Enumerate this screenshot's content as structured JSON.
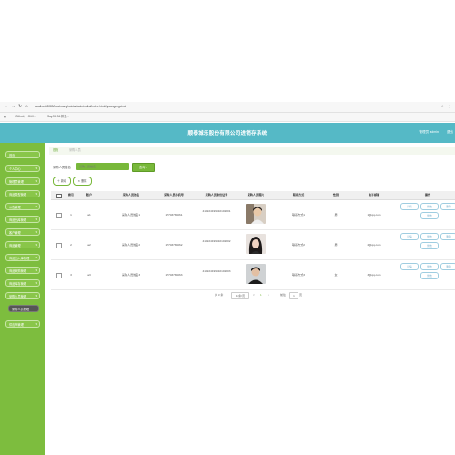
{
  "browser": {
    "url": "localhost:8080/louchuanghuixiao/admin/dist/index.html#/yuangongxinxi",
    "bookmarks": [
      "【Github】 GitH...",
      "SayCA 06.排之..."
    ]
  },
  "header": {
    "title": "顺泰城乐股份有限公司进销存系统",
    "user": "管理员 admin",
    "exit": "退出"
  },
  "sidebar": {
    "items": [
      {
        "label": "首页",
        "arrow": ""
      },
      {
        "label": "个人中心",
        "arrow": "▾"
      },
      {
        "label": "管理员管理",
        "arrow": "▾"
      },
      {
        "label": "商品类型管理",
        "arrow": "▾"
      },
      {
        "label": "公告管理",
        "arrow": "▾"
      },
      {
        "label": "商品出库管理",
        "arrow": "▾"
      },
      {
        "label": "客户管理",
        "arrow": "▾"
      },
      {
        "label": "商品管理",
        "arrow": "▾"
      },
      {
        "label": "商品出入库管理",
        "arrow": "▾"
      },
      {
        "label": "商品采购管理",
        "arrow": "▾"
      },
      {
        "label": "商品库存管理",
        "arrow": "▾"
      },
      {
        "label": "采购人员管理",
        "arrow": "▾"
      },
      {
        "label": "采购人员管理",
        "arrow": ""
      },
      {
        "label": "供应商管理",
        "arrow": "▾"
      }
    ]
  },
  "breadcrumb": {
    "home": "首页",
    "current": "采购人员"
  },
  "search": {
    "label": "采购人员姓名",
    "placeholder": "采购人员姓名",
    "button": "查询"
  },
  "actions": {
    "add": "新增",
    "delete": "删除"
  },
  "table": {
    "columns": [
      "索引",
      "账户",
      "采购人员姓名",
      "采购人员手机号",
      "采购人员身份证号",
      "采购人员照片",
      "联系方式",
      "性别",
      "电子邮箱",
      "操作"
    ],
    "rows": [
      {
        "index": "1",
        "account": "a1",
        "name": "采购人员姓名1",
        "phone": "17703786661",
        "idcard": "410224199910102001",
        "contact": "联系方式1",
        "gender": "男",
        "email": "1@qq.com"
      },
      {
        "index": "2",
        "account": "a2",
        "name": "采购人员姓名2",
        "phone": "17703786662",
        "idcard": "410224199910102002",
        "contact": "联系方式2",
        "gender": "男",
        "email": "2@qq.com"
      },
      {
        "index": "3",
        "account": "a3",
        "name": "采购人员姓名3",
        "phone": "17703786663",
        "idcard": "410224199910102003",
        "contact": "联系方式3",
        "gender": "女",
        "email": "3@qq.com"
      }
    ],
    "row_buttons": [
      "详情",
      "修改",
      "删除",
      "修改"
    ]
  },
  "pager": {
    "total": "共 3 条",
    "size": "10条/页",
    "prev": "<",
    "page": "1",
    "next": ">",
    "goto": "前往",
    "goto_page": "1",
    "page_unit": "页"
  },
  "colors": {
    "header": "#55b9c6",
    "sidebar": "#7dbd3e",
    "accent": "#78b83a"
  }
}
